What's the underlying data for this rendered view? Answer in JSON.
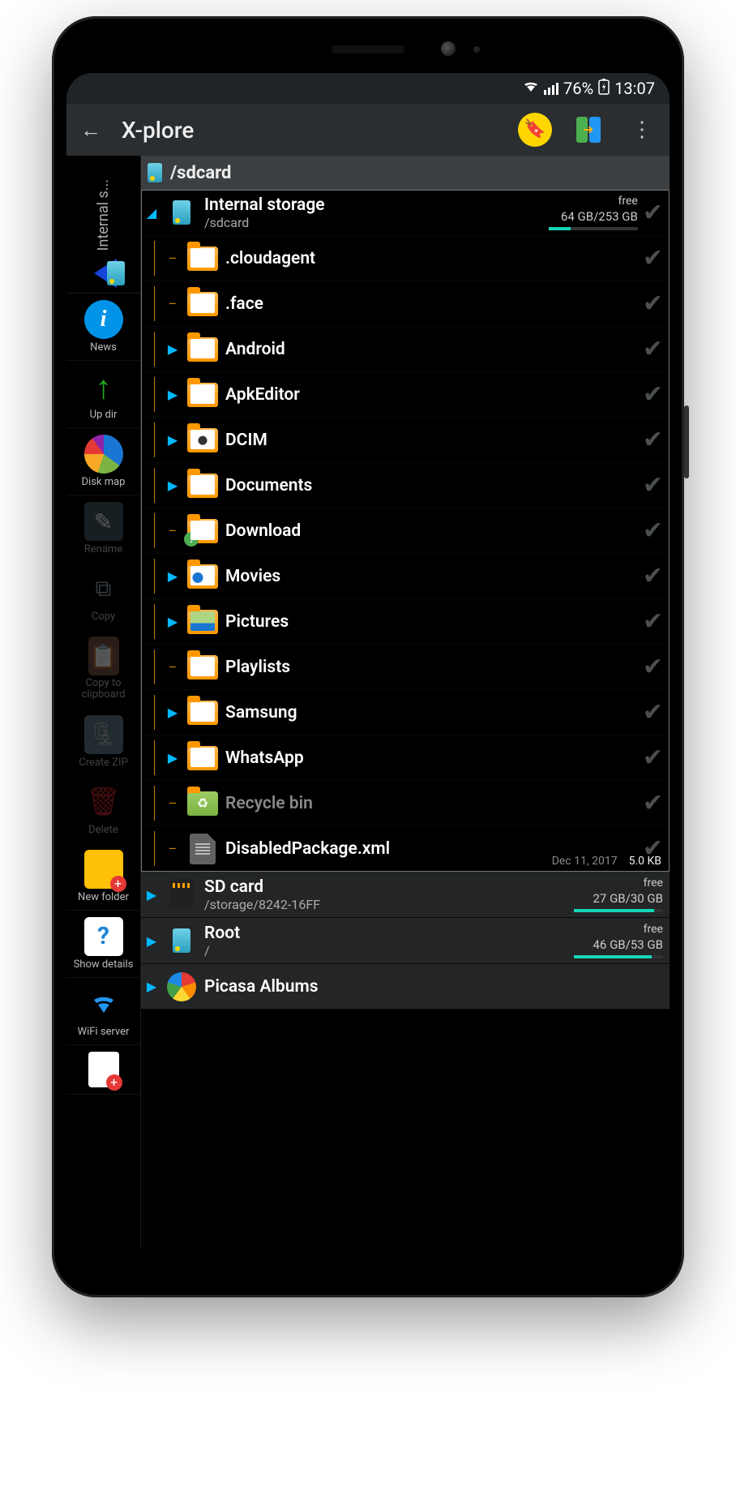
{
  "status_bar": {
    "battery_pct": "76%",
    "time": "13:07"
  },
  "app_bar": {
    "title": "X-plore"
  },
  "left_pane_tab": {
    "label": "Internal s..."
  },
  "rail": [
    {
      "key": "news",
      "label": "News"
    },
    {
      "key": "updir",
      "label": "Up dir"
    },
    {
      "key": "diskmap",
      "label": "Disk map"
    },
    {
      "key": "rename",
      "label": "Rename",
      "dim": true
    },
    {
      "key": "copy",
      "label": "Copy",
      "dim": true
    },
    {
      "key": "copyclip",
      "label": "Copy to clipboard",
      "dim": true
    },
    {
      "key": "createzip",
      "label": "Create ZIP",
      "dim": true
    },
    {
      "key": "delete",
      "label": "Delete",
      "dim": true
    },
    {
      "key": "newfolder",
      "label": "New folder"
    },
    {
      "key": "showdetails",
      "label": "Show details"
    },
    {
      "key": "wifiserver",
      "label": "WiFi server"
    },
    {
      "key": "newfile",
      "label": ""
    }
  ],
  "path_bar": {
    "path": "/sdcard"
  },
  "volumes": {
    "internal": {
      "name": "Internal storage",
      "path": "/sdcard",
      "free_label": "free",
      "free": "64 GB",
      "total": "253 GB",
      "used_pct": 75
    },
    "sdcard": {
      "name": "SD card",
      "path": "/storage/8242-16FF",
      "free_label": "free",
      "free": "27 GB",
      "total": "30 GB",
      "used_pct": 10
    },
    "root": {
      "name": "Root",
      "path": "/",
      "free_label": "free",
      "free": "46 GB",
      "total": "53 GB",
      "used_pct": 13
    },
    "picasa": {
      "name": "Picasa Albums"
    }
  },
  "folders": [
    {
      "name": ".cloudagent",
      "expandable": false
    },
    {
      "name": ".face",
      "expandable": false
    },
    {
      "name": "Android",
      "expandable": true
    },
    {
      "name": "ApkEditor",
      "expandable": true
    },
    {
      "name": "DCIM",
      "expandable": true,
      "variant": "dcim"
    },
    {
      "name": "Documents",
      "expandable": true
    },
    {
      "name": "Download",
      "expandable": false,
      "variant": "download"
    },
    {
      "name": "Movies",
      "expandable": true,
      "variant": "movies"
    },
    {
      "name": "Pictures",
      "expandable": true,
      "variant": "pictures"
    },
    {
      "name": "Playlists",
      "expandable": false
    },
    {
      "name": "Samsung",
      "expandable": true
    },
    {
      "name": "WhatsApp",
      "expandable": true
    },
    {
      "name": "Recycle bin",
      "expandable": false,
      "variant": "recycle",
      "dim": true
    }
  ],
  "files": [
    {
      "name": "DisabledPackage",
      "ext": ".xml",
      "date": "Dec 11, 2017",
      "size": "5.0 KB"
    }
  ]
}
